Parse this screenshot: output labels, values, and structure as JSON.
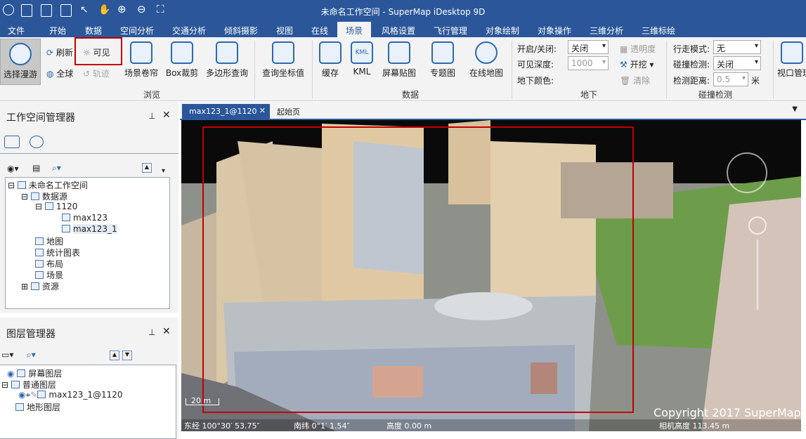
{
  "title_bar": {
    "title": "未命名工作空间 - SuperMap iDesktop 9D"
  },
  "menu": [
    "文件",
    "开始",
    "数据",
    "空间分析",
    "交通分析",
    "倾斜摄影",
    "视图",
    "在线",
    "场景",
    "风格设置",
    "飞行管理",
    "对象绘制",
    "对象操作",
    "三维分析",
    "三维标绘"
  ],
  "ribbon": {
    "browse": {
      "roam": "选择漫游",
      "refresh": "刷新",
      "globe": "全球",
      "visible": "可见",
      "track": "轨迹",
      "curtain": "场景卷帘",
      "box_clip": "Box裁剪",
      "poly_query": "多边形查询",
      "query_coord": "查询坐标值",
      "group": "浏览"
    },
    "data": {
      "cache": "缓存",
      "kml": "KML",
      "screen_paste": "屏幕贴图",
      "thematic": "专题图",
      "online_map": "在线地图",
      "kml_icon": "KML",
      "group": "数据"
    },
    "underground": {
      "onoff_label": "开启/关闭:",
      "onoff_value": "关闭",
      "depth_label": "可见深度:",
      "depth_value": "1000",
      "color_label": "地下颜色:",
      "transparency": "透明度",
      "excavate": "开挖",
      "clear": "清除",
      "group": "地下"
    },
    "collision": {
      "mode_label": "行走模式:",
      "mode_value": "无",
      "detect_label": "碰撞检测:",
      "detect_value": "关闭",
      "dist_label": "检测距离:",
      "dist_value": "0.5",
      "unit": "米",
      "group": "碰撞检测"
    },
    "viewport": "视口管理"
  },
  "workspace_panel": {
    "title": "工作空间管理器",
    "tree": [
      {
        "label": "未命名工作空间"
      },
      {
        "label": "数据源"
      },
      {
        "label": "1120"
      },
      {
        "label": "max123"
      },
      {
        "label": "max123_1"
      },
      {
        "label": "地图"
      },
      {
        "label": "统计图表"
      },
      {
        "label": "布局"
      },
      {
        "label": "场景"
      },
      {
        "label": "资源"
      }
    ]
  },
  "layer_panel": {
    "title": "图层管理器",
    "tree": [
      {
        "label": "屏幕图层"
      },
      {
        "label": "普通图层"
      },
      {
        "label": "max123_1@1120"
      },
      {
        "label": "地形图层"
      }
    ]
  },
  "tabs": {
    "active": "max123_1@1120",
    "other": "起始页"
  },
  "scene": {
    "scale": "20 m",
    "copyright": "Copyright 2017 SuperMap",
    "status_lon": "东经 100°30′ 53.75″",
    "status_lat": "南纬 0°1′ 1.54″",
    "status_elev": "高度 0.00 m",
    "status_cam": "相机高度 113.45 m"
  },
  "colors": {
    "accent": "#2b579a",
    "highlight": "#c00000"
  }
}
